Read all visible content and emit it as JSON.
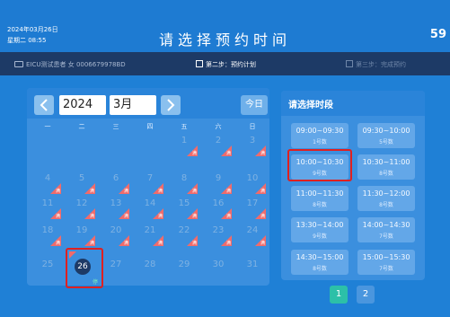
{
  "header": {
    "date": "2024年03月26日",
    "weekday_time": "星期二 08:55",
    "title": "请选择预约时间",
    "countdown": "59"
  },
  "steps": {
    "patient": "EICU测试患者 女 0006679978BD",
    "current": "第二步：预约计划",
    "next": "第三步：完成预约"
  },
  "calendar": {
    "year": "2024",
    "month": "3月",
    "today_label": "今日",
    "weekdays": [
      "一",
      "二",
      "三",
      "四",
      "五",
      "六",
      "日"
    ],
    "full_marker": "满",
    "selected_marker": "停",
    "selected_day": "26",
    "rows": [
      [
        {
          "d": "",
          "f": false
        },
        {
          "d": "",
          "f": false
        },
        {
          "d": "",
          "f": false
        },
        {
          "d": "",
          "f": false
        },
        {
          "d": "1",
          "f": true
        },
        {
          "d": "2",
          "f": true
        },
        {
          "d": "3",
          "f": true
        }
      ],
      [
        {
          "d": "4",
          "f": true
        },
        {
          "d": "5",
          "f": true
        },
        {
          "d": "6",
          "f": true
        },
        {
          "d": "7",
          "f": true
        },
        {
          "d": "8",
          "f": true
        },
        {
          "d": "9",
          "f": true
        },
        {
          "d": "10",
          "f": true
        }
      ],
      [
        {
          "d": "11",
          "f": true
        },
        {
          "d": "12",
          "f": true
        },
        {
          "d": "13",
          "f": true
        },
        {
          "d": "14",
          "f": true
        },
        {
          "d": "15",
          "f": true
        },
        {
          "d": "16",
          "f": true
        },
        {
          "d": "17",
          "f": true
        }
      ],
      [
        {
          "d": "18",
          "f": true
        },
        {
          "d": "19",
          "f": true
        },
        {
          "d": "20",
          "f": true
        },
        {
          "d": "21",
          "f": true
        },
        {
          "d": "22",
          "f": true
        },
        {
          "d": "23",
          "f": true
        },
        {
          "d": "24",
          "f": true
        }
      ],
      [
        {
          "d": "25",
          "f": false
        },
        {
          "d": "",
          "f": false
        },
        {
          "d": "27",
          "f": false
        },
        {
          "d": "28",
          "f": false
        },
        {
          "d": "29",
          "f": false
        },
        {
          "d": "30",
          "f": false
        },
        {
          "d": "31",
          "f": false
        }
      ]
    ]
  },
  "slots": {
    "title": "请选择时段",
    "items": [
      {
        "time": "09:00~09:30",
        "count": "1号数"
      },
      {
        "time": "09:30~10:00",
        "count": "5号数"
      },
      {
        "time": "10:00~10:30",
        "count": "9号数"
      },
      {
        "time": "10:30~11:00",
        "count": "8号数"
      },
      {
        "time": "11:00~11:30",
        "count": "8号数"
      },
      {
        "time": "11:30~12:00",
        "count": "8号数"
      },
      {
        "time": "13:30~14:00",
        "count": "9号数"
      },
      {
        "time": "14:00~14:30",
        "count": "7号数"
      },
      {
        "time": "14:30~15:00",
        "count": "8号数"
      },
      {
        "time": "15:00~15:30",
        "count": "7号数"
      }
    ],
    "selected_index": 2
  },
  "pagination": {
    "pages": [
      "1",
      "2"
    ],
    "active": 0
  },
  "colors": {
    "full_marker": "#f06b6b",
    "selected_outline": "#e02020",
    "page_active": "#2cc0a8"
  }
}
